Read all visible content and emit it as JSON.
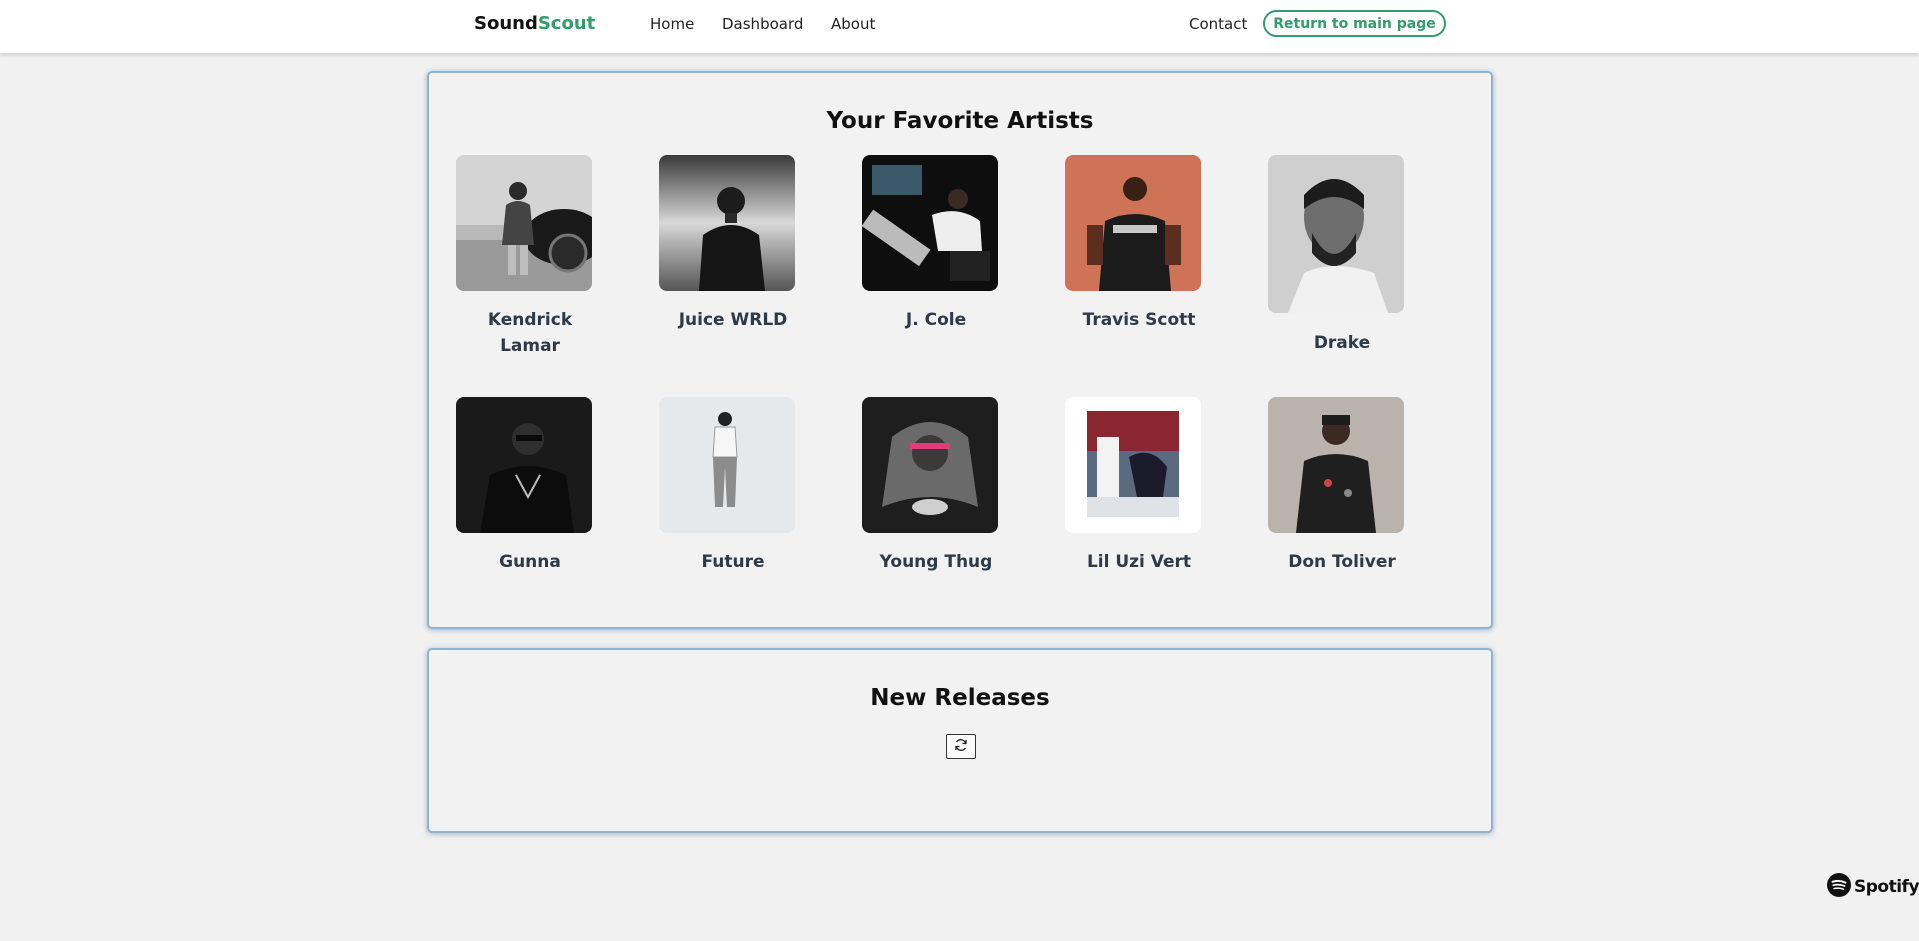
{
  "navbar": {
    "brand_part1": "Sound",
    "brand_part2": "Scout",
    "links": [
      "Home",
      "Dashboard",
      "About"
    ],
    "contact": "Contact",
    "return_button": "Return to main page"
  },
  "favorites": {
    "title": "Your Favorite Artists",
    "artists": [
      {
        "name": "Kendrick Lamar"
      },
      {
        "name": "Juice WRLD"
      },
      {
        "name": "J. Cole"
      },
      {
        "name": "Travis Scott"
      },
      {
        "name": "Drake"
      },
      {
        "name": "Gunna"
      },
      {
        "name": "Future"
      },
      {
        "name": "Young Thug"
      },
      {
        "name": "Lil Uzi Vert"
      },
      {
        "name": "Don Toliver"
      }
    ]
  },
  "releases": {
    "title": "New Releases",
    "refresh_icon": "refresh-icon"
  },
  "footer": {
    "spotify_label": "Spotify"
  },
  "colors": {
    "accent": "#2f9e6a",
    "panel_border": "#8fb4d2",
    "background": "#f1f1f1"
  }
}
